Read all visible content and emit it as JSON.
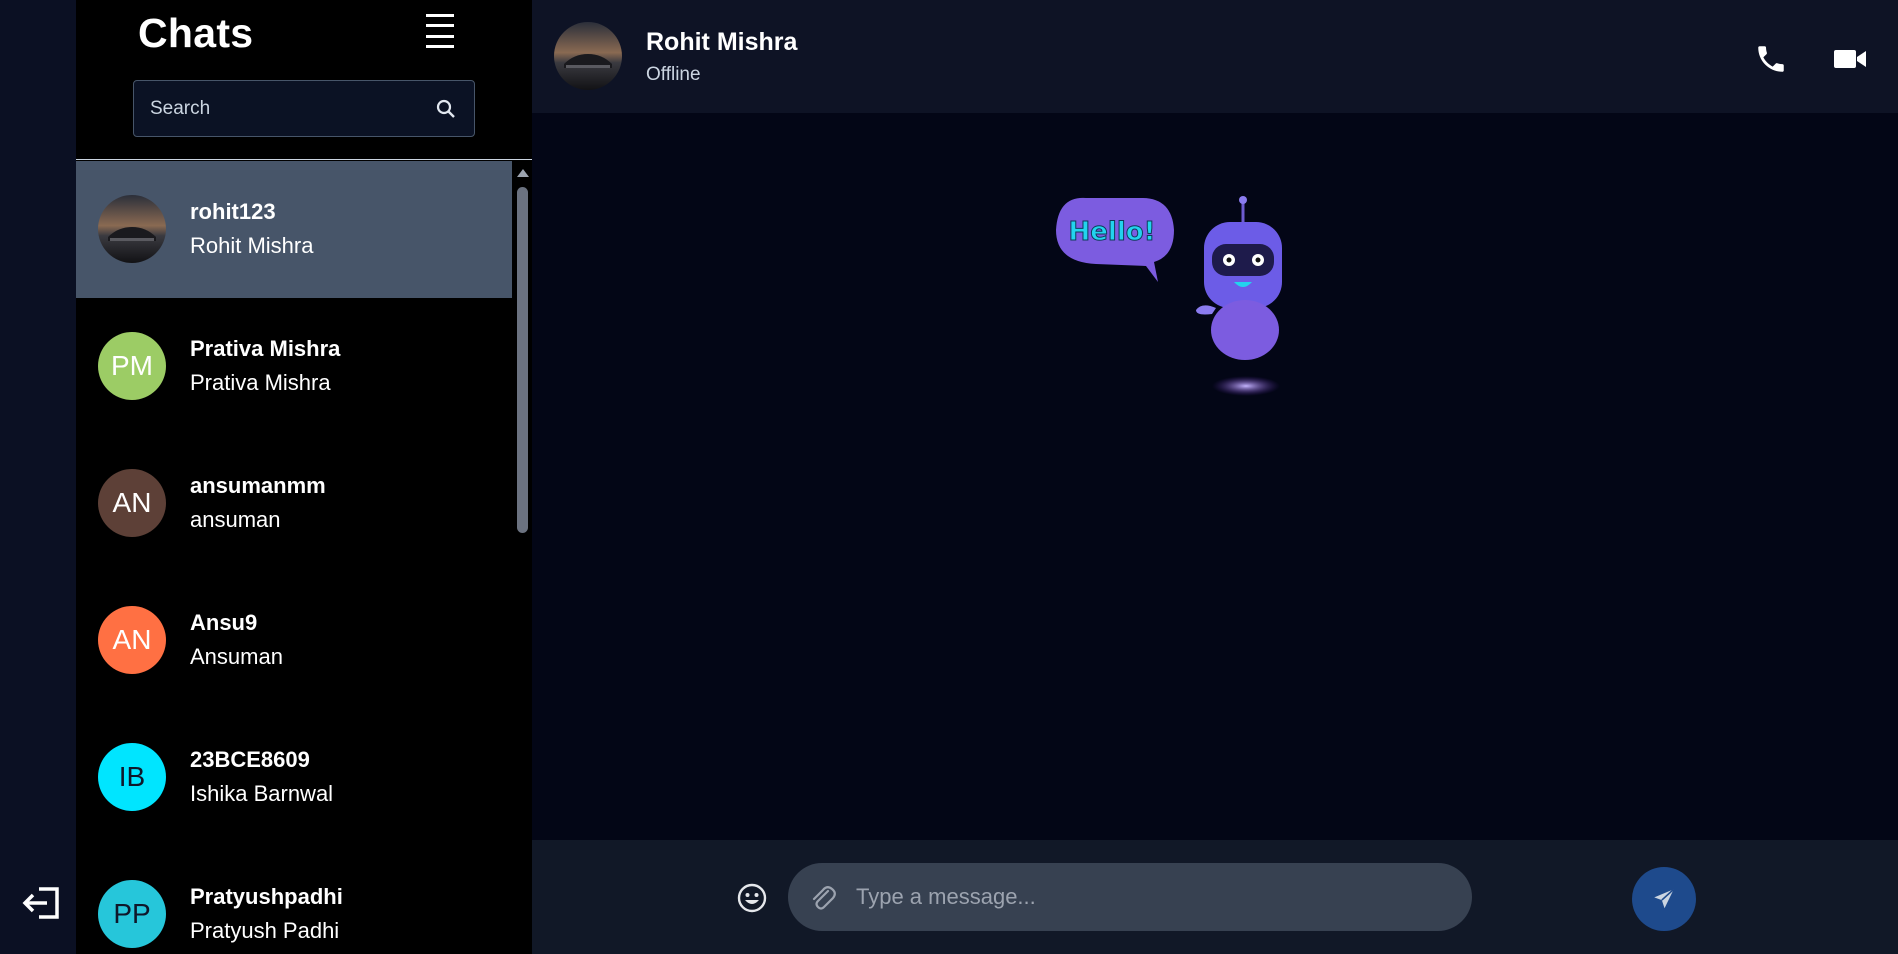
{
  "sidebar": {
    "title": "Chats",
    "search_placeholder": "Search",
    "chats": [
      {
        "username": "rohit123",
        "name": "Rohit Mishra",
        "avatar_type": "photo",
        "active": true
      },
      {
        "username": "Prativa Mishra",
        "name": "Prativa Mishra",
        "initials": "PM",
        "color": "#9ccc65",
        "text_dark": false
      },
      {
        "username": "ansumanmm",
        "name": "ansuman",
        "initials": "AN",
        "color": "#5d4037",
        "text_dark": false
      },
      {
        "username": "Ansu9",
        "name": "Ansuman",
        "initials": "AN",
        "color": "#ff7043",
        "text_dark": false
      },
      {
        "username": "23BCE8609",
        "name": "Ishika Barnwal",
        "initials": "IB",
        "color": "#00e5ff",
        "text_dark": true
      },
      {
        "username": "Pratyushpadhi",
        "name": "Pratyush Padhi",
        "initials": "PP",
        "color": "#26c6da",
        "text_dark": true
      }
    ]
  },
  "chat": {
    "contact_name": "Rohit Mishra",
    "status": "Offline",
    "greeting_sticker_text": "Hello!"
  },
  "composer": {
    "placeholder": "Type a message..."
  },
  "colors": {
    "active_chat": "#475569",
    "send_button": "#1e4a8c",
    "robot": "#6c5ce7"
  }
}
